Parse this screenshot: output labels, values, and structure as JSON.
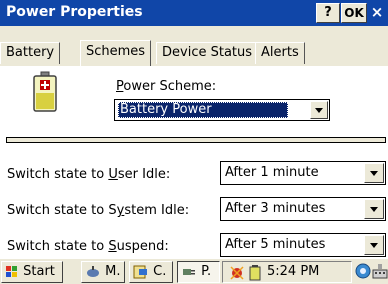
{
  "window": {
    "title": "Power Properties",
    "help_label": "?",
    "ok_label": "OK",
    "close_label": "×"
  },
  "tabs": [
    {
      "label": "Battery"
    },
    {
      "label": "Schemes"
    },
    {
      "label": "Device Status"
    },
    {
      "label": "Alerts"
    }
  ],
  "schemes": {
    "power_scheme_label_prefix": "",
    "power_scheme_label_mnemonic": "P",
    "power_scheme_label_rest": "ower Scheme:",
    "power_scheme_value": "Battery Power",
    "rows": [
      {
        "label_pre": "Switch state to ",
        "mnemonic": "U",
        "label_post": "ser Idle:",
        "value": "After 1 minute"
      },
      {
        "label_pre": "Switch state to S",
        "mnemonic": "y",
        "label_post": "stem Idle:",
        "value": "After 3 minutes"
      },
      {
        "label_pre": "Switch state to ",
        "mnemonic": "S",
        "label_post": "uspend:",
        "value": "After 5 minutes"
      }
    ]
  },
  "taskbar": {
    "start_label": "Start",
    "items": [
      {
        "label": "M."
      },
      {
        "label": "C."
      },
      {
        "label": "P."
      }
    ],
    "time": "5:24 PM"
  },
  "colors": {
    "titlebar": "#1046a8",
    "selection": "#0a246a",
    "dialog_bg": "#ece9d8"
  }
}
